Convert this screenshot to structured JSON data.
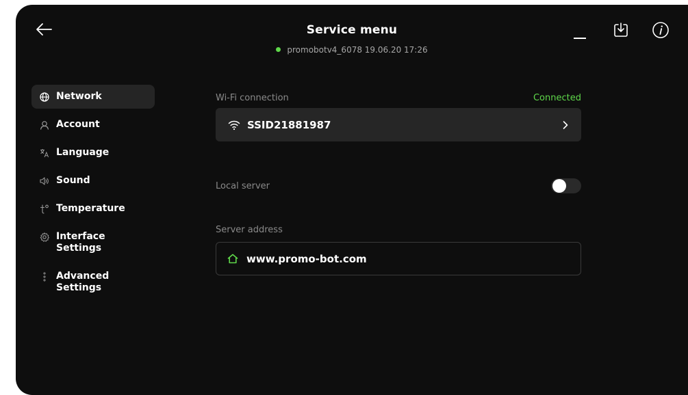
{
  "header": {
    "title": "Service menu",
    "device_info": "promobotv4_6078 19.06.20  17:26",
    "status_color": "#5fd84a",
    "icons": [
      "back-arrow-icon",
      "minimize-icon",
      "download-icon",
      "info-icon"
    ]
  },
  "sidebar": {
    "items": [
      {
        "label": "Network",
        "icon": "globe-icon",
        "active": true
      },
      {
        "label": "Account",
        "icon": "person-icon",
        "active": false
      },
      {
        "label": "Language",
        "icon": "translate-icon",
        "active": false
      },
      {
        "label": "Sound",
        "icon": "speaker-icon",
        "active": false
      },
      {
        "label": "Temperature",
        "icon": "thermometer-icon",
        "active": false
      },
      {
        "label": "Interface\nSettings",
        "icon": "gear-icon",
        "active": false
      },
      {
        "label": "Advanced\nSettings",
        "icon": "vertical-dots-icon",
        "active": false
      }
    ]
  },
  "network": {
    "wifi_label": "Wi-Fi connection",
    "wifi_status": "Connected",
    "wifi_ssid": "SSID21881987",
    "local_server_label": "Local server",
    "local_server_enabled": false,
    "server_address_label": "Server address",
    "server_address_value": "www.promo-bot.com"
  }
}
